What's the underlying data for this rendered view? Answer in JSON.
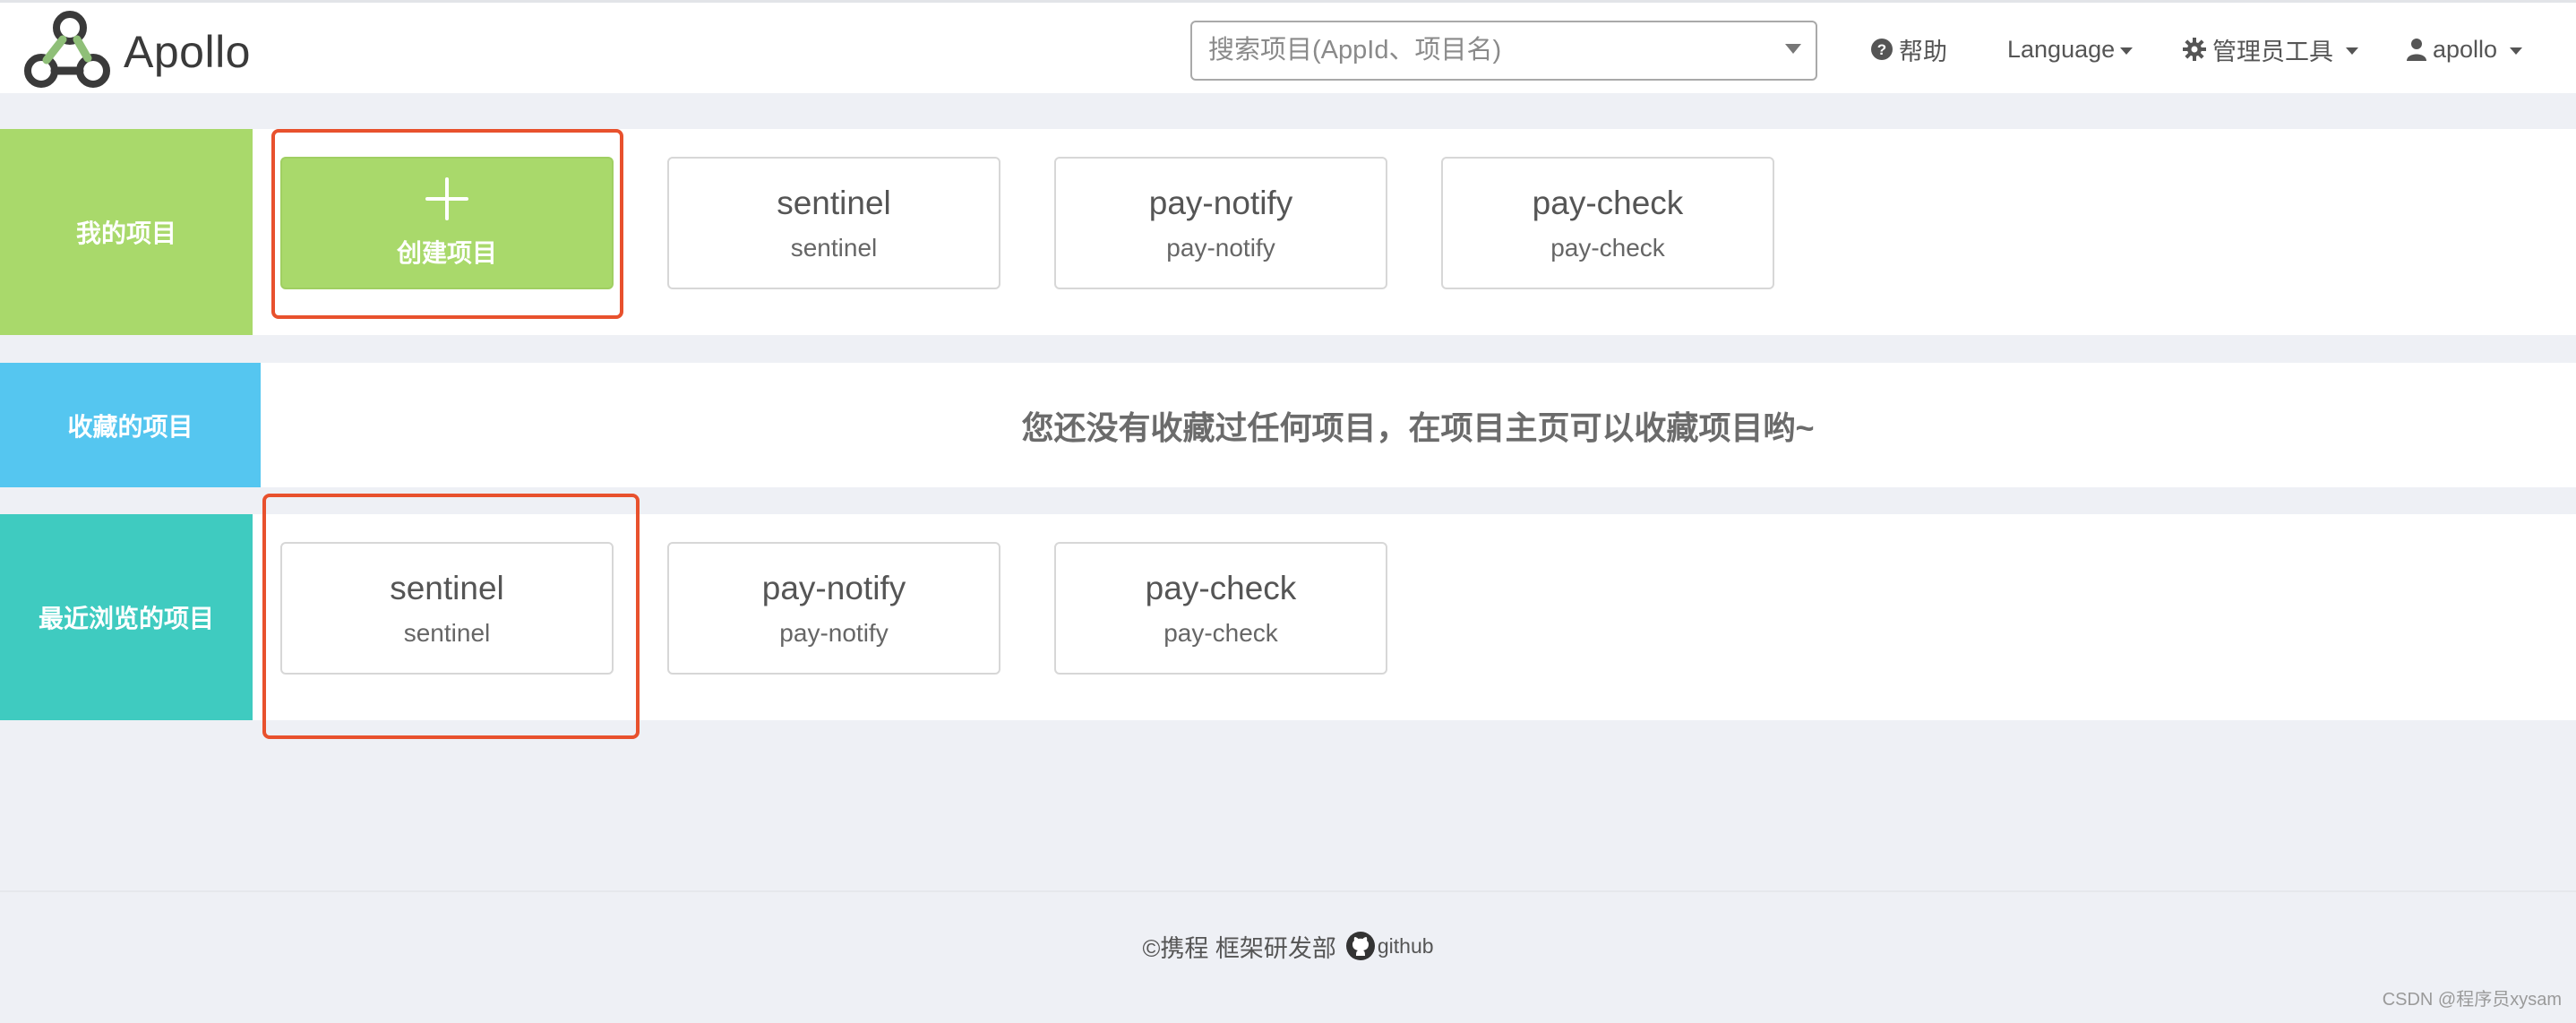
{
  "header": {
    "app_name": "Apollo",
    "search_placeholder": "搜索项目(AppId、项目名)",
    "help_label": "帮助",
    "language_label": "Language",
    "admin_tools_label": "管理员工具",
    "user_label": "apollo"
  },
  "my_projects": {
    "label": "我的项目",
    "color": "#a9d96b",
    "create_label": "创建项目",
    "items": [
      {
        "title": "sentinel",
        "subtitle": "sentinel"
      },
      {
        "title": "pay-notify",
        "subtitle": "pay-notify"
      },
      {
        "title": "pay-check",
        "subtitle": "pay-check"
      }
    ]
  },
  "favorites": {
    "label": "收藏的项目",
    "color": "#55c6f0",
    "empty_message": "您还没有收藏过任何项目，在项目主页可以收藏项目哟~"
  },
  "recent": {
    "label": "最近浏览的项目",
    "color": "#3fcbc0",
    "items": [
      {
        "title": "sentinel",
        "subtitle": "sentinel"
      },
      {
        "title": "pay-notify",
        "subtitle": "pay-notify"
      },
      {
        "title": "pay-check",
        "subtitle": "pay-check"
      }
    ]
  },
  "footer": {
    "copyright": "©携程 框架研发部",
    "github_label": "github"
  },
  "watermark": "CSDN @程序员xysam",
  "highlight_color": "#e8512d"
}
